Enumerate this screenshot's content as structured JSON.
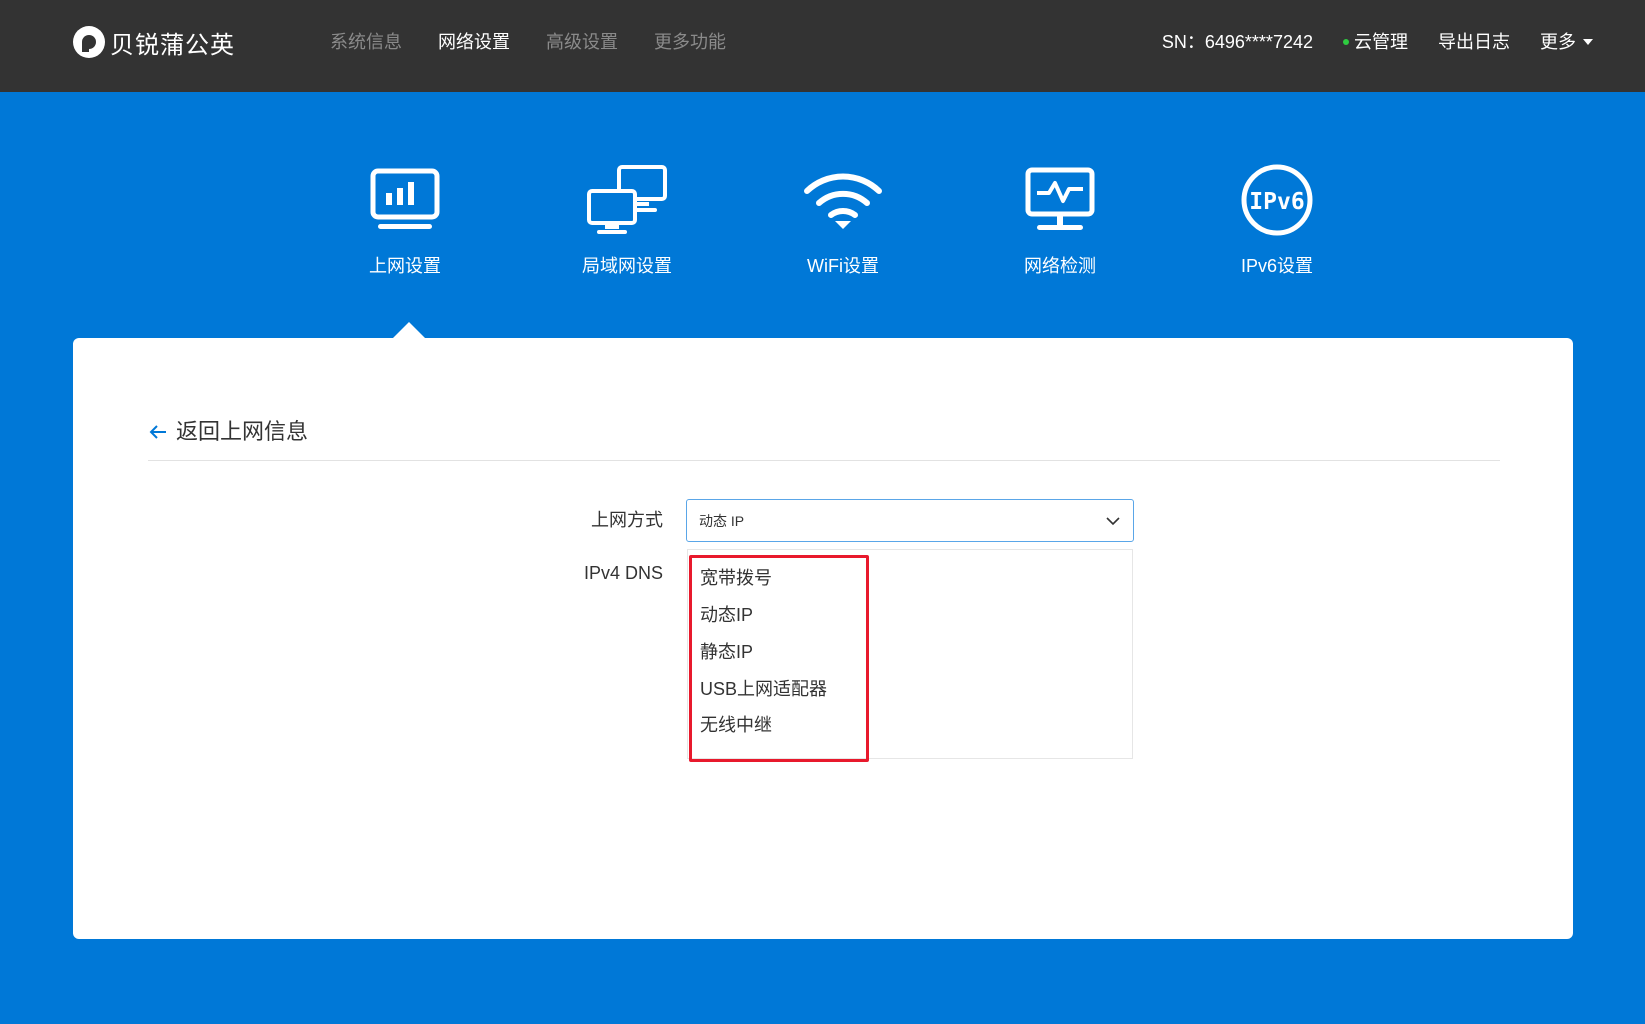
{
  "brand": {
    "name": "贝锐蒲公英"
  },
  "mainnav": [
    {
      "label": "系统信息",
      "active": false
    },
    {
      "label": "网络设置",
      "active": true
    },
    {
      "label": "高级设置",
      "active": false
    },
    {
      "label": "更多功能",
      "active": false
    }
  ],
  "rightnav": {
    "sn": "SN：6496****7242",
    "cloud": "云管理",
    "export": "导出日志",
    "more": "更多"
  },
  "tabs": [
    {
      "label": "上网设置",
      "icon": "monitor-chart-icon",
      "active": true
    },
    {
      "label": "局域网设置",
      "icon": "lan-computers-icon",
      "active": false
    },
    {
      "label": "WiFi设置",
      "icon": "wifi-icon",
      "active": false
    },
    {
      "label": "网络检测",
      "icon": "monitor-pulse-icon",
      "active": false
    },
    {
      "label": "IPv6设置",
      "icon": "ipv6-icon",
      "active": false
    }
  ],
  "content": {
    "back_label": "返回上网信息",
    "wan_mode_label": "上网方式",
    "wan_mode_value": "动态 IP",
    "dns_label": "IPv4 DNS",
    "options": [
      "宽带拨号",
      "动态IP",
      "静态IP",
      "USB上网适配器",
      "无线中继"
    ]
  },
  "colors": {
    "topbar": "#333333",
    "accent_blue": "#0078d7",
    "highlight_red": "#e8192c",
    "status_green": "#2ecc40"
  }
}
